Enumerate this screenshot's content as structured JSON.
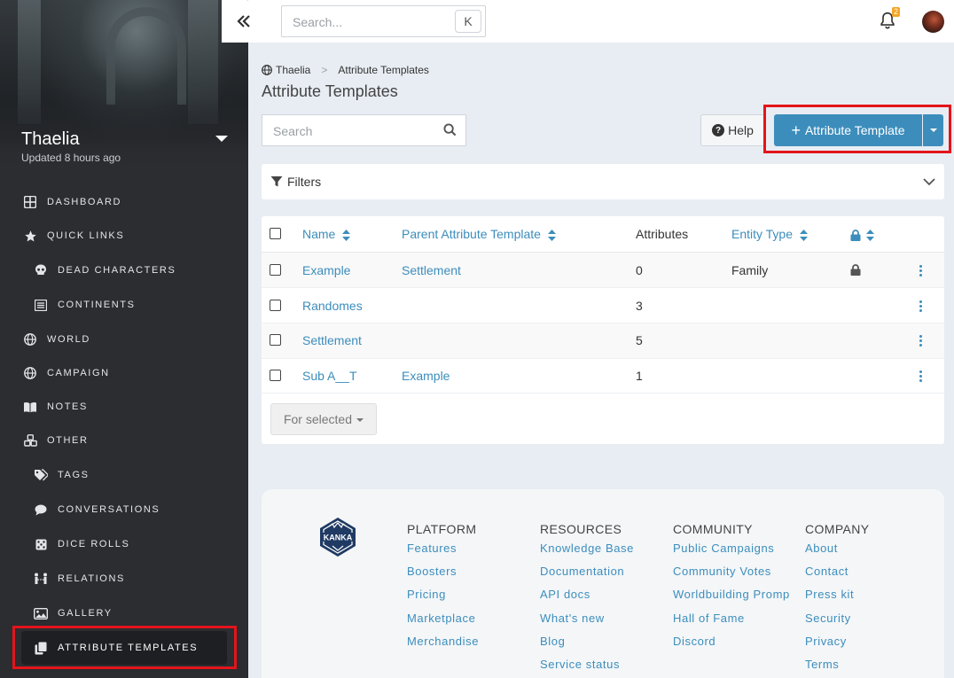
{
  "campaign": {
    "name": "Thaelia",
    "updated": "Updated 8 hours ago"
  },
  "sidebar": {
    "items": [
      {
        "label": "DASHBOARD",
        "icon": "dashboard-icon"
      },
      {
        "label": "QUICK LINKS",
        "icon": "star-icon"
      },
      {
        "label": "DEAD CHARACTERS",
        "icon": "skull-icon"
      },
      {
        "label": "CONTINENTS",
        "icon": "list-icon"
      },
      {
        "label": "WORLD",
        "icon": "globe-icon"
      },
      {
        "label": "CAMPAIGN",
        "icon": "globe-icon"
      },
      {
        "label": "NOTES",
        "icon": "book-icon"
      },
      {
        "label": "OTHER",
        "icon": "cubes-icon"
      },
      {
        "label": "TAGS",
        "icon": "tags-icon"
      },
      {
        "label": "CONVERSATIONS",
        "icon": "comment-icon"
      },
      {
        "label": "DICE ROLLS",
        "icon": "dice-icon"
      },
      {
        "label": "RELATIONS",
        "icon": "relations-icon"
      },
      {
        "label": "GALLERY",
        "icon": "images-icon"
      },
      {
        "label": "ATTRIBUTE TEMPLATES",
        "icon": "copy-icon"
      }
    ]
  },
  "topbar": {
    "search_placeholder": "Search...",
    "shortcut": "K",
    "notification_count": "2"
  },
  "breadcrumb": {
    "root": "Thaelia",
    "sep": ">",
    "current": "Attribute Templates"
  },
  "page": {
    "title": "Attribute Templates"
  },
  "toolbar": {
    "search_placeholder": "Search",
    "help_label": "Help",
    "create_label": "Attribute Template",
    "accent": "#3c8dbc"
  },
  "filters": {
    "label": "Filters"
  },
  "table": {
    "headers": [
      "Name",
      "Parent Attribute Template",
      "Attributes",
      "Entity Type"
    ],
    "rows": [
      {
        "name": "Example",
        "parent": "Settlement",
        "attributes": "0",
        "entity_type": "Family",
        "private": true
      },
      {
        "name": "Randomes",
        "parent": "",
        "attributes": "3",
        "entity_type": "",
        "private": false
      },
      {
        "name": "Settlement",
        "parent": "",
        "attributes": "5",
        "entity_type": "",
        "private": false
      },
      {
        "name": "Sub A__T",
        "parent": "Example",
        "attributes": "1",
        "entity_type": "",
        "private": false
      }
    ],
    "bulk_label": "For selected"
  },
  "footer": {
    "columns": [
      {
        "heading": "PLATFORM",
        "links": [
          "Features",
          "Boosters",
          "Pricing",
          "Marketplace",
          "Merchandise"
        ]
      },
      {
        "heading": "RESOURCES",
        "links": [
          "Knowledge Base",
          "Documentation",
          "API docs",
          "What's new",
          "Blog",
          "Service status"
        ]
      },
      {
        "heading": "COMMUNITY",
        "links": [
          "Public Campaigns",
          "Community Votes",
          "Worldbuilding Promp",
          "Hall of Fame",
          "Discord"
        ]
      },
      {
        "heading": "COMPANY",
        "links": [
          "About",
          "Contact",
          "Press kit",
          "Security",
          "Privacy",
          "Terms"
        ]
      }
    ],
    "logo_text": "KANKA"
  }
}
